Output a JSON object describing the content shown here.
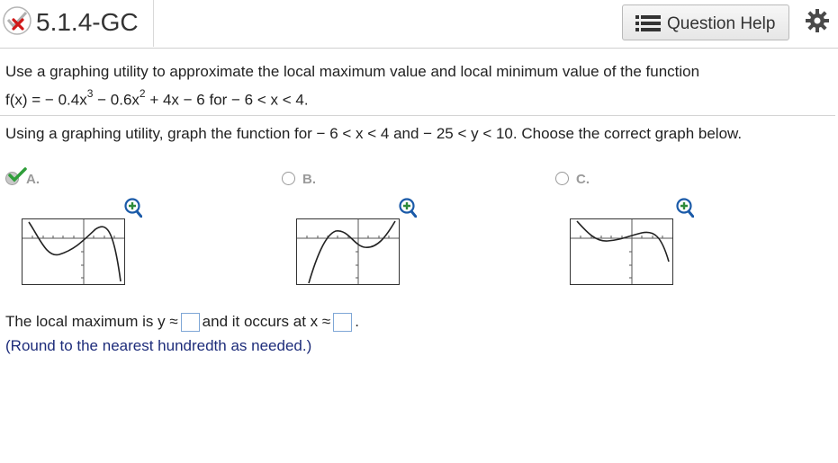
{
  "header": {
    "title": "5.1.4-GC",
    "help_label": "Question Help",
    "status_icon": "partial-credit-x-icon",
    "colors": {
      "check": "#2f9e3a",
      "x": "#d01818"
    }
  },
  "question": {
    "line1": "Use a graphing utility to approximate the local maximum value and local minimum value of the function",
    "func_a": "f(x) = − 0.4x",
    "exp1": "3",
    "func_b": " − 0.6x",
    "exp2": "2",
    "func_c": " + 4x − 6 for  − 6 < x < 4.",
    "line3": "Using a graphing utility, graph the function for  − 6 < x < 4 and  − 25 < y < 10. Choose the correct graph below."
  },
  "options": [
    {
      "letter": "A.",
      "selected": true
    },
    {
      "letter": "B.",
      "selected": false
    },
    {
      "letter": "C.",
      "selected": false
    }
  ],
  "answer": {
    "prefix": "The local maximum is y ≈",
    "middle": "and it occurs at x ≈",
    "suffix": ".",
    "hint": "(Round to the nearest hundredth as needed.)",
    "y_value": "",
    "x_value": ""
  }
}
